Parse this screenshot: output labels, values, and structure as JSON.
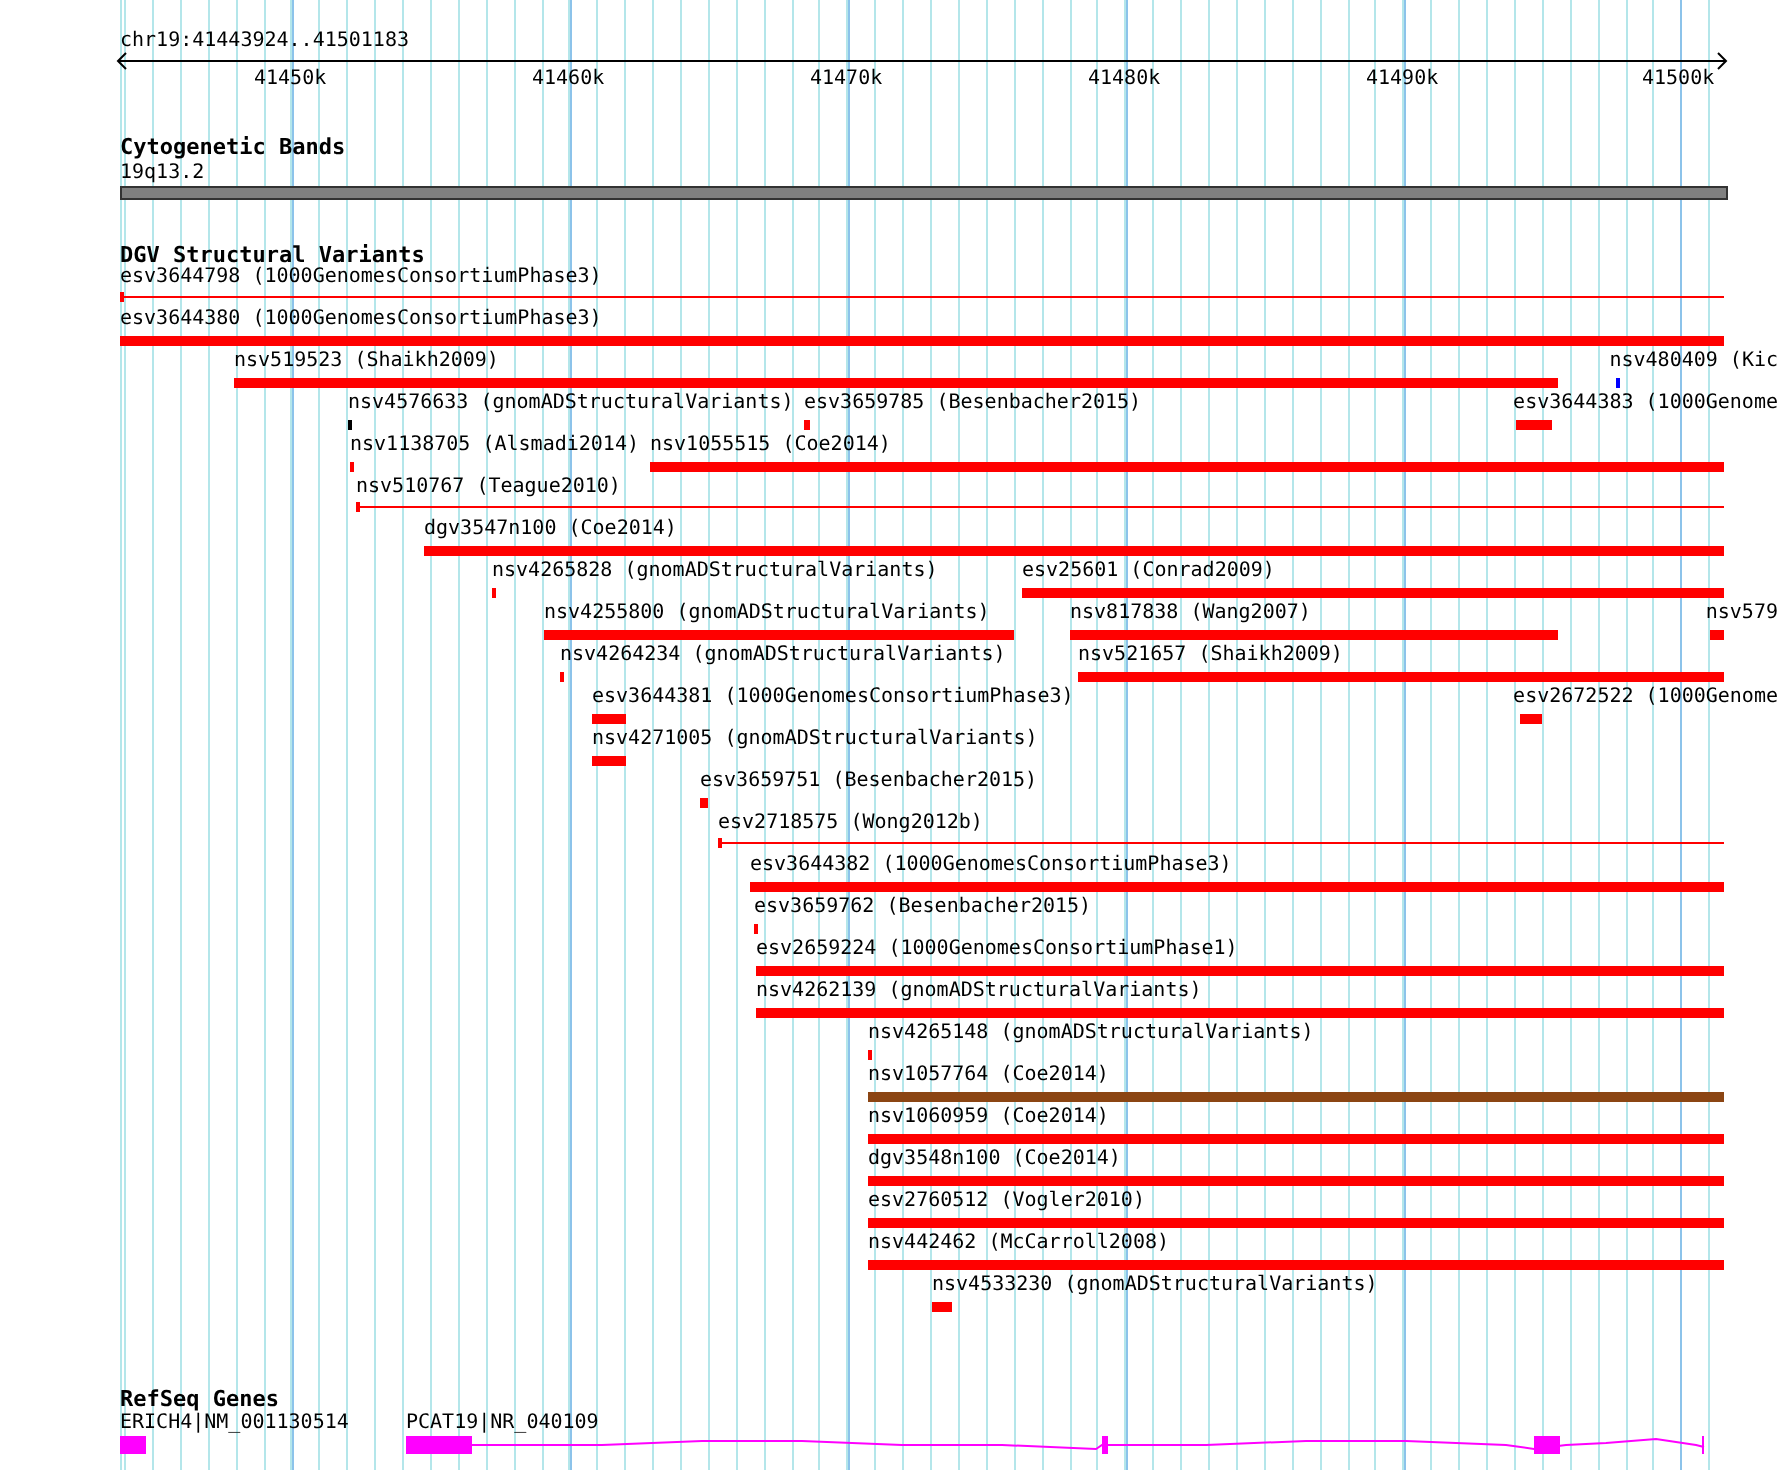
{
  "ruler": {
    "location": "chr19:41443924..41501183",
    "ticks": [
      "41450k",
      "41460k",
      "41470k",
      "41480k",
      "41490k",
      "41500k"
    ]
  },
  "tracks": [
    {
      "title": "Cytogenetic Bands",
      "kind": "bands",
      "features": [
        {
          "label": "19q13.2"
        }
      ]
    },
    {
      "title": "DGV Structural Variants",
      "kind": "variants",
      "features": [
        {
          "label": "esv3644798 (1000GenomesConsortiumPhase3)",
          "kind": "line",
          "color": "#ff0000"
        },
        {
          "label": "esv3644380 (1000GenomesConsortiumPhase3)",
          "kind": "bar",
          "color": "#ff0000"
        },
        {
          "label": "nsv519523 (Shaikh2009)",
          "kind": "bar",
          "color": "#ff0000"
        },
        {
          "label": "nsv480409 (Kic",
          "kind": "bar",
          "color": "#0000ff"
        },
        {
          "label": "nsv4576633 (gnomADStructuralVariants)",
          "kind": "bar",
          "color": "#000000"
        },
        {
          "label": "esv3659785 (Besenbacher2015)",
          "kind": "bar",
          "color": "#ff0000"
        },
        {
          "label": "esv3644383 (1000Genome",
          "kind": "bar",
          "color": "#ff0000"
        },
        {
          "label": "nsv1138705 (Alsmadi2014)",
          "kind": "bar",
          "color": "#ff0000"
        },
        {
          "label": "nsv1055515 (Coe2014)",
          "kind": "bar",
          "color": "#ff0000"
        },
        {
          "label": "nsv510767 (Teague2010)",
          "kind": "line",
          "color": "#ff0000"
        },
        {
          "label": "dgv3547n100 (Coe2014)",
          "kind": "bar",
          "color": "#ff0000"
        },
        {
          "label": "nsv4265828 (gnomADStructuralVariants)",
          "kind": "bar",
          "color": "#ff0000"
        },
        {
          "label": "esv25601 (Conrad2009)",
          "kind": "bar",
          "color": "#ff0000"
        },
        {
          "label": "nsv4255800 (gnomADStructuralVariants)",
          "kind": "bar",
          "color": "#ff0000"
        },
        {
          "label": "nsv817838 (Wang2007)",
          "kind": "bar",
          "color": "#ff0000"
        },
        {
          "label": "nsv579",
          "kind": "bar",
          "color": "#ff0000"
        },
        {
          "label": "nsv4264234 (gnomADStructuralVariants)",
          "kind": "bar",
          "color": "#ff0000"
        },
        {
          "label": "nsv521657 (Shaikh2009)",
          "kind": "bar",
          "color": "#ff0000"
        },
        {
          "label": "esv3644381 (1000GenomesConsortiumPhase3)",
          "kind": "bar",
          "color": "#ff0000"
        },
        {
          "label": "esv2672522 (1000Genome",
          "kind": "bar",
          "color": "#ff0000"
        },
        {
          "label": "nsv4271005 (gnomADStructuralVariants)",
          "kind": "bar",
          "color": "#ff0000"
        },
        {
          "label": "esv3659751 (Besenbacher2015)",
          "kind": "bar",
          "color": "#ff0000"
        },
        {
          "label": "esv2718575 (Wong2012b)",
          "kind": "line",
          "color": "#ff0000"
        },
        {
          "label": "esv3644382 (1000GenomesConsortiumPhase3)",
          "kind": "bar",
          "color": "#ff0000"
        },
        {
          "label": "esv3659762 (Besenbacher2015)",
          "kind": "bar",
          "color": "#ff0000"
        },
        {
          "label": "esv2659224 (1000GenomesConsortiumPhase1)",
          "kind": "bar",
          "color": "#ff0000"
        },
        {
          "label": "nsv4262139 (gnomADStructuralVariants)",
          "kind": "bar",
          "color": "#ff0000"
        },
        {
          "label": "nsv4265148 (gnomADStructuralVariants)",
          "kind": "bar",
          "color": "#ff0000"
        },
        {
          "label": "nsv1057764 (Coe2014)",
          "kind": "bar",
          "color": "#8b4513"
        },
        {
          "label": "nsv1060959 (Coe2014)",
          "kind": "bar",
          "color": "#ff0000"
        },
        {
          "label": "dgv3548n100 (Coe2014)",
          "kind": "bar",
          "color": "#ff0000"
        },
        {
          "label": "esv2760512 (Vogler2010)",
          "kind": "bar",
          "color": "#ff0000"
        },
        {
          "label": "nsv442462 (McCarroll2008)",
          "kind": "bar",
          "color": "#ff0000"
        },
        {
          "label": "nsv4533230 (gnomADStructuralVariants)",
          "kind": "bar",
          "color": "#ff0000"
        }
      ]
    },
    {
      "title": "RefSeq Genes",
      "kind": "genes",
      "features": [
        {
          "label": "ERICH4|NM_001130514"
        },
        {
          "label": "PCAT19|NR_040109"
        }
      ]
    }
  ]
}
